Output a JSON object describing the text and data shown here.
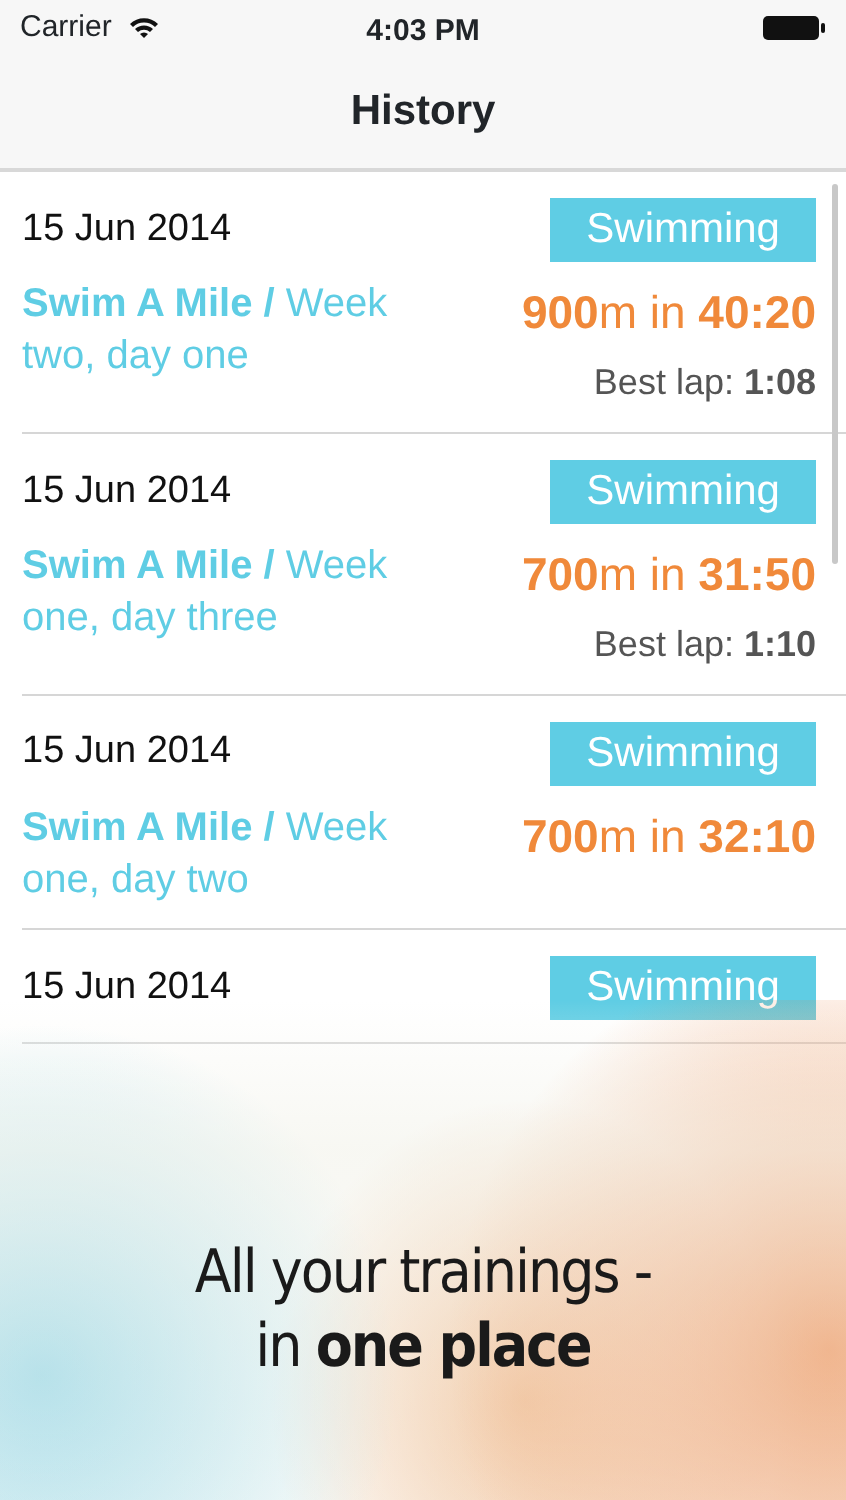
{
  "status_bar": {
    "carrier": "Carrier",
    "time": "4:03 PM"
  },
  "nav": {
    "title": "History"
  },
  "rows": [
    {
      "date": "15 Jun 2014",
      "tag": "Swimming",
      "title": "**Swim A Mile /** Week two, day one",
      "result": "**900**m in **40:20**",
      "best_lap": "Best lap: **1:08**"
    },
    {
      "date": "15 Jun 2014",
      "tag": "Swimming",
      "title": "**Swim A Mile /** Week one, day three",
      "result": "**700**m in **31:50**",
      "best_lap": "Best lap: **1:10**"
    },
    {
      "date": "15 Jun 2014",
      "tag": "Swimming",
      "title": "**Swim A Mile /** Week one, day two",
      "result": "**700**m in **32:10**"
    },
    {
      "date": "15 Jun 2014",
      "tag": "Swimming"
    }
  ],
  "promo": {
    "lines": [
      "All your trainings -",
      "in **one place**"
    ]
  }
}
